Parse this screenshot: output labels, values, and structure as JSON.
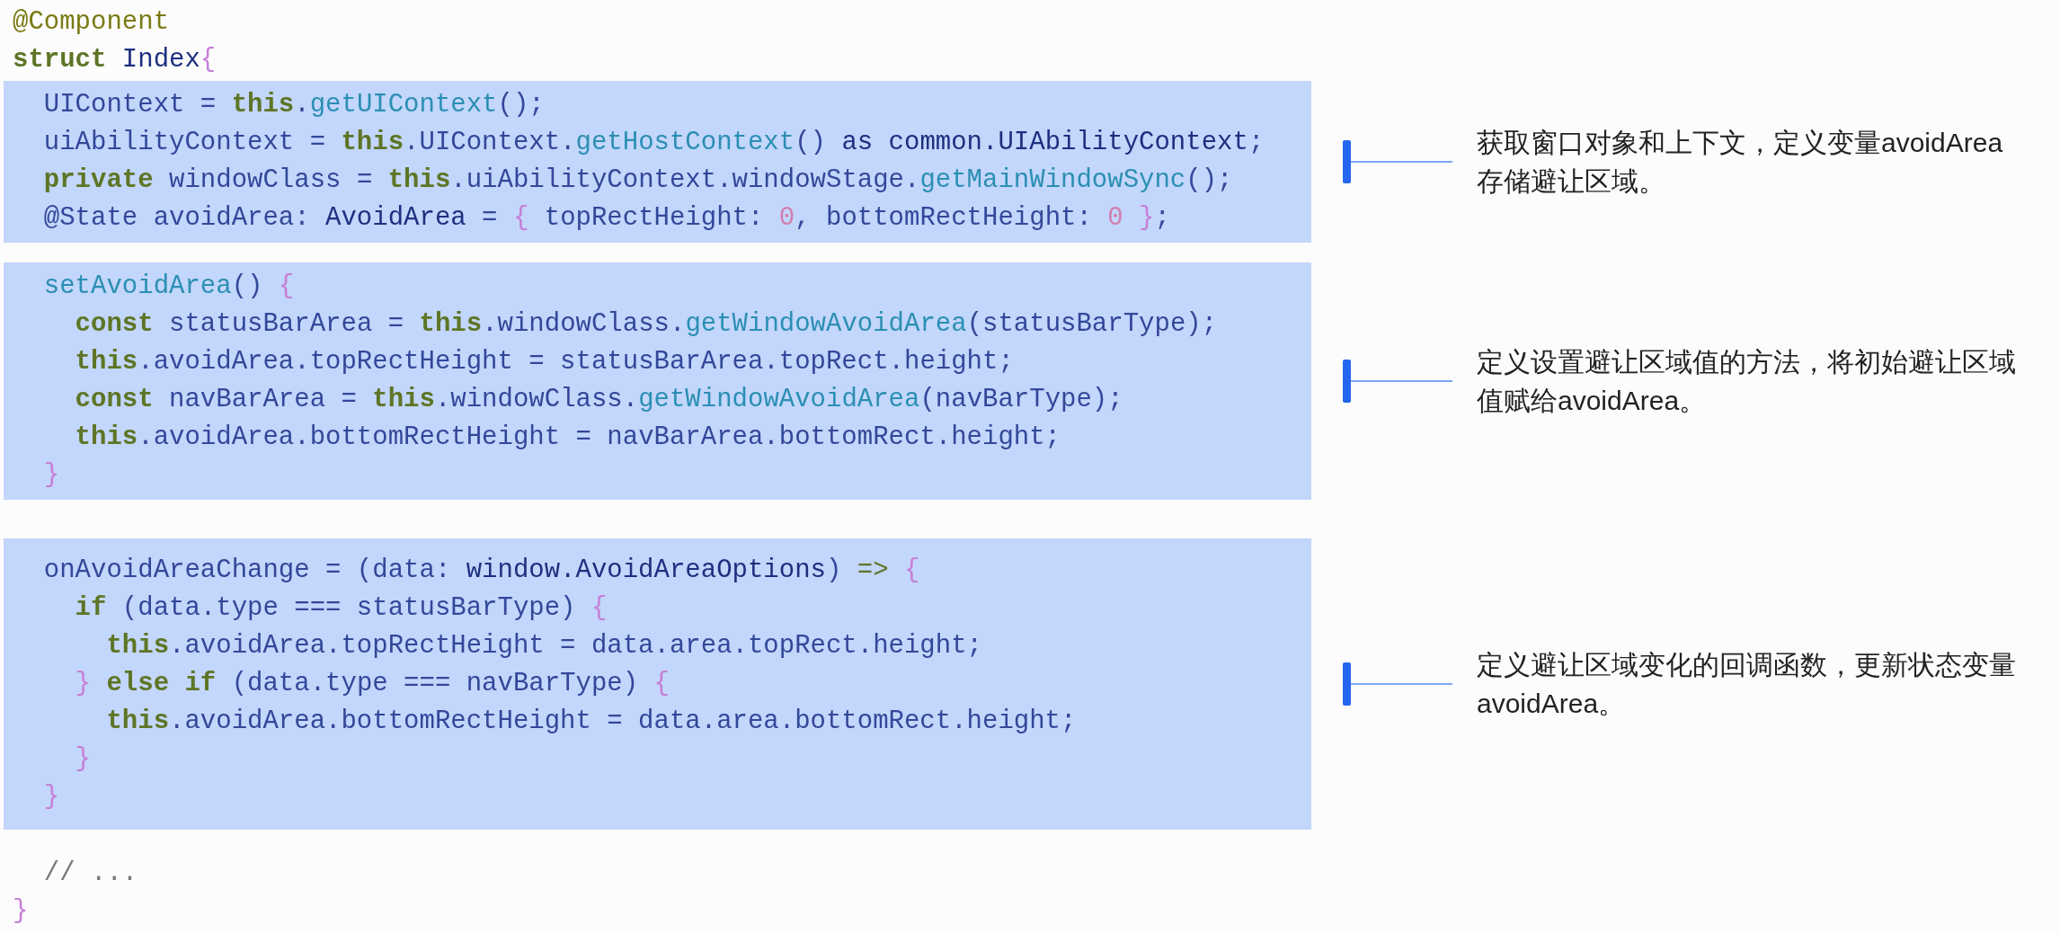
{
  "header_lines": [
    [
      {
        "kind": "decorator",
        "text": "@Component"
      }
    ],
    [
      {
        "kind": "keyword",
        "text": "struct"
      },
      {
        "kind": "type",
        "text": " Index"
      },
      {
        "kind": "brace",
        "text": "{"
      }
    ]
  ],
  "blocks": [
    {
      "lines": [
        [
          {
            "kind": "plain",
            "text": "  UIContext = "
          },
          {
            "kind": "keyword",
            "text": "this"
          },
          {
            "kind": "plain",
            "text": "."
          },
          {
            "kind": "function",
            "text": "getUIContext"
          },
          {
            "kind": "plain",
            "text": "();"
          }
        ],
        [
          {
            "kind": "plain",
            "text": "  uiAbilityContext = "
          },
          {
            "kind": "keyword",
            "text": "this"
          },
          {
            "kind": "plain",
            "text": ".UIContext."
          },
          {
            "kind": "function",
            "text": "getHostContext"
          },
          {
            "kind": "plain",
            "text": "() "
          },
          {
            "kind": "type",
            "text": "as common.UIAbilityContext"
          },
          {
            "kind": "plain",
            "text": ";"
          }
        ],
        [
          {
            "kind": "keyword",
            "text": "  private"
          },
          {
            "kind": "plain",
            "text": " windowClass = "
          },
          {
            "kind": "keyword",
            "text": "this"
          },
          {
            "kind": "plain",
            "text": ".uiAbilityContext.windowStage."
          },
          {
            "kind": "function",
            "text": "getMainWindowSync"
          },
          {
            "kind": "plain",
            "text": "();"
          }
        ],
        [
          {
            "kind": "plain",
            "text": "  @State avoidArea: "
          },
          {
            "kind": "type",
            "text": "AvoidArea"
          },
          {
            "kind": "plain",
            "text": " = "
          },
          {
            "kind": "brace",
            "text": "{"
          },
          {
            "kind": "plain",
            "text": " topRectHeight: "
          },
          {
            "kind": "number",
            "text": "0"
          },
          {
            "kind": "plain",
            "text": ", bottomRectHeight: "
          },
          {
            "kind": "number",
            "text": "0"
          },
          {
            "kind": "brace",
            "text": " }"
          },
          {
            "kind": "plain",
            "text": ";"
          }
        ]
      ],
      "note": "获取窗口对象和上下文，定义变量avoidArea存储避让区域。"
    },
    {
      "lines": [
        [
          {
            "kind": "function",
            "text": "  setAvoidArea"
          },
          {
            "kind": "plain",
            "text": "() "
          },
          {
            "kind": "brace",
            "text": "{"
          }
        ],
        [
          {
            "kind": "keyword",
            "text": "    const"
          },
          {
            "kind": "plain",
            "text": " statusBarArea = "
          },
          {
            "kind": "keyword",
            "text": "this"
          },
          {
            "kind": "plain",
            "text": ".windowClass."
          },
          {
            "kind": "function",
            "text": "getWindowAvoidArea"
          },
          {
            "kind": "plain",
            "text": "(statusBarType);"
          }
        ],
        [
          {
            "kind": "keyword",
            "text": "    this"
          },
          {
            "kind": "plain",
            "text": ".avoidArea.topRectHeight = statusBarArea.topRect.height;"
          }
        ],
        [
          {
            "kind": "keyword",
            "text": "    const"
          },
          {
            "kind": "plain",
            "text": " navBarArea = "
          },
          {
            "kind": "keyword",
            "text": "this"
          },
          {
            "kind": "plain",
            "text": ".windowClass."
          },
          {
            "kind": "function",
            "text": "getWindowAvoidArea"
          },
          {
            "kind": "plain",
            "text": "(navBarType);"
          }
        ],
        [
          {
            "kind": "keyword",
            "text": "    this"
          },
          {
            "kind": "plain",
            "text": ".avoidArea.bottomRectHeight = navBarArea.bottomRect.height;"
          }
        ],
        [
          {
            "kind": "brace",
            "text": "  }"
          }
        ]
      ],
      "note": "定义设置避让区域值的方法，将初始避让区域值赋给avoidArea。"
    },
    {
      "lines": [
        [
          {
            "kind": "plain",
            "text": "  onAvoidAreaChange = (data: "
          },
          {
            "kind": "type",
            "text": "window.AvoidAreaOptions"
          },
          {
            "kind": "plain",
            "text": ") "
          },
          {
            "kind": "operator",
            "text": "=>"
          },
          {
            "kind": "brace",
            "text": " {"
          }
        ],
        [
          {
            "kind": "keyword",
            "text": "    if"
          },
          {
            "kind": "plain",
            "text": " (data.type === statusBarType) "
          },
          {
            "kind": "brace",
            "text": "{"
          }
        ],
        [
          {
            "kind": "keyword",
            "text": "      this"
          },
          {
            "kind": "plain",
            "text": ".avoidArea.topRectHeight = data.area.topRect.height;"
          }
        ],
        [
          {
            "kind": "brace",
            "text": "    } "
          },
          {
            "kind": "keyword",
            "text": "else if"
          },
          {
            "kind": "plain",
            "text": " (data.type === navBarType) "
          },
          {
            "kind": "brace",
            "text": "{"
          }
        ],
        [
          {
            "kind": "keyword",
            "text": "      this"
          },
          {
            "kind": "plain",
            "text": ".avoidArea.bottomRectHeight = data.area.bottomRect.height;"
          }
        ],
        [
          {
            "kind": "brace",
            "text": "    }"
          }
        ],
        [
          {
            "kind": "brace",
            "text": "  }"
          }
        ]
      ],
      "note": "定义避让区域变化的回调函数，更新状态变量avoidArea。"
    }
  ],
  "footer_lines": [
    [
      {
        "kind": "comment",
        "text": "  // ..."
      }
    ],
    [
      {
        "kind": "brace",
        "text": "}"
      }
    ]
  ]
}
